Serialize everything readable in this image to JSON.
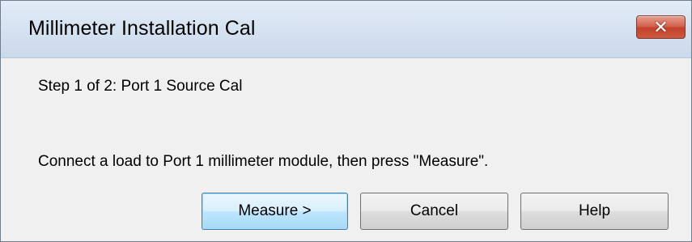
{
  "window": {
    "title": "Millimeter Installation Cal",
    "close_icon": "close-icon"
  },
  "content": {
    "step_label": "Step 1 of 2: Port 1 Source Cal",
    "instruction": "Connect a load to Port 1 millimeter module, then press \"Measure\"."
  },
  "buttons": {
    "measure_label": "Measure >",
    "cancel_label": "Cancel",
    "help_label": "Help"
  },
  "colors": {
    "title_bar": "#d4e1f0",
    "close_button": "#c4412b",
    "dialog_background": "#f0f0f0",
    "default_button_border": "#3c7fb1"
  }
}
